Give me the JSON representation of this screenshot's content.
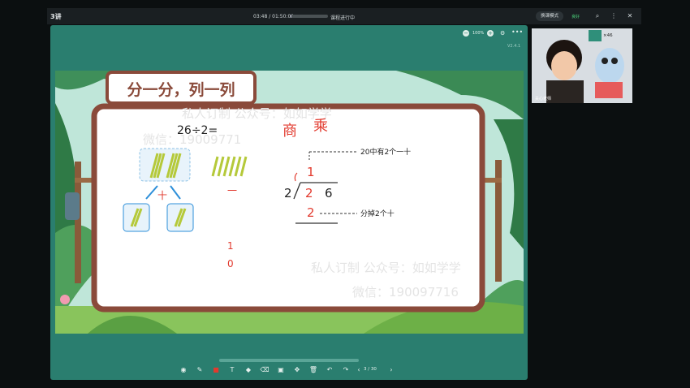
{
  "topbar": {
    "lesson_title": "3讲",
    "timer": "03:48 / 01:50:00",
    "progress_fraction": 0.03,
    "status": "课程进行中",
    "switch_label": "换课模式",
    "net_status": "良好"
  },
  "panel": {
    "zoom_level": "100%",
    "version": "V2.4.1",
    "page_indicator": "3 / 30"
  },
  "slide": {
    "title": "分一分，列一列",
    "equation": "26÷2=",
    "watermark_line1": "私人订制  公众号：如如学学",
    "watermark_line2": "微信：19009771",
    "watermark_line3": "私人订制  公众号：如如学学",
    "watermark_line4": "微信：190097716",
    "handwritten_shang": "商",
    "handwritten_cheng": "乘",
    "handwritten_ten": "十",
    "handwritten_one": "一",
    "handwritten_10_a": "1",
    "handwritten_10_b": "0",
    "divisor": "2",
    "dividend_tens": "2",
    "dividend_ones": "6",
    "quotient_tens": "1",
    "product": "2",
    "note_top": "20中有2个一十",
    "note_bottom": "分掉2个十"
  },
  "video": {
    "teacher_name": "夫心老师",
    "reward_count": "×46"
  },
  "colors": {
    "panel_bg": "#2a7e6f",
    "accent_red": "#e23a2e",
    "board_bg": "#ffffff",
    "board_border": "#8a4a3a"
  },
  "icons": {
    "toolbar": [
      "record-icon",
      "pen-icon",
      "color-icon",
      "text-icon",
      "shape-icon",
      "eraser-icon",
      "screenshot-icon",
      "move-icon",
      "delete-icon",
      "undo-icon",
      "redo-icon",
      "prev-page-icon",
      "next-page-icon"
    ]
  }
}
